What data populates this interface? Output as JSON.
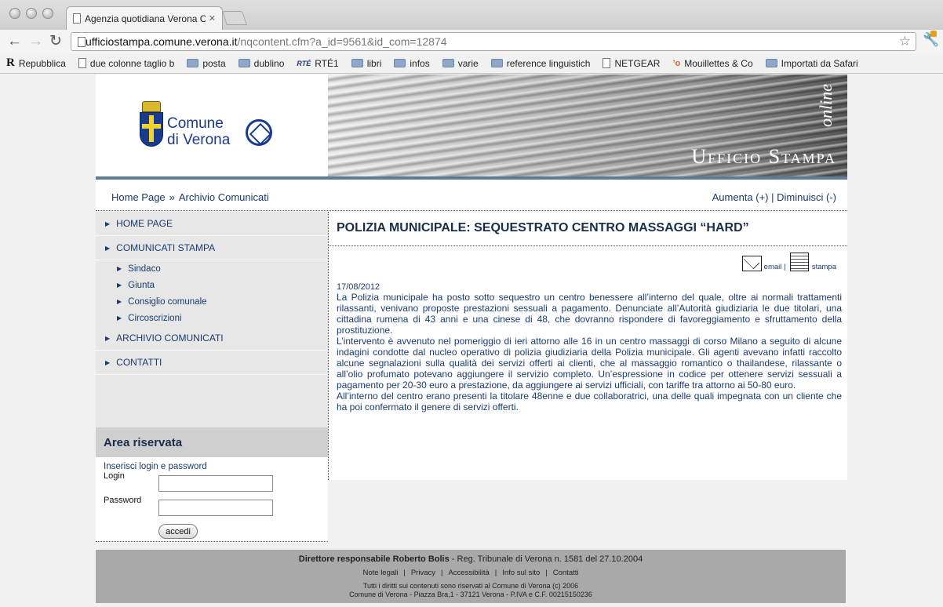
{
  "browser": {
    "tab_title": "Agenzia quotidiana Verona C",
    "tab_close": "✕",
    "url_host": "ufficiostampa.comune.verona.it",
    "url_path": "/nqcontent.cfm?a_id=9561&id_com=12874",
    "bookmarks": [
      {
        "label": "Repubblica",
        "icon": "r-icon"
      },
      {
        "label": "due colonne taglio b",
        "icon": "page-icon"
      },
      {
        "label": "posta",
        "icon": "folder-icon"
      },
      {
        "label": "dublino",
        "icon": "folder-icon"
      },
      {
        "label": "RTÉ1",
        "icon": "rte-icon",
        "icon_text": "RTÉ"
      },
      {
        "label": "libri",
        "icon": "folder-icon"
      },
      {
        "label": "infos",
        "icon": "folder-icon"
      },
      {
        "label": "varie",
        "icon": "folder-icon"
      },
      {
        "label": "reference linguistich",
        "icon": "folder-icon"
      },
      {
        "label": "NETGEAR",
        "icon": "page-icon"
      },
      {
        "label": "Mouillettes & Co",
        "icon": "mouillettes-icon",
        "icon_text": "’o"
      },
      {
        "label": "Importati da Safari",
        "icon": "folder-icon"
      }
    ]
  },
  "header": {
    "logo_line1": "Comune",
    "logo_line2": "di Verona",
    "banner_online": "online",
    "banner_title": "Ufficio Stampa"
  },
  "breadcrumb": {
    "home": "Home Page",
    "separator": "»",
    "current": "Archivio Comunicati"
  },
  "font_size": {
    "increase": "Aumenta (+)",
    "separator": "|",
    "decrease": "Diminuisci (-)"
  },
  "sidebar": {
    "items": [
      {
        "label": "HOME PAGE",
        "level": 1
      },
      {
        "label": "COMUNICATI STAMPA",
        "level": 1
      },
      {
        "label": "Sindaco",
        "level": 2
      },
      {
        "label": "Giunta",
        "level": 2
      },
      {
        "label": "Consiglio comunale",
        "level": 2
      },
      {
        "label": "Circoscrizioni",
        "level": 2
      },
      {
        "label": "ARCHIVIO COMUNICATI",
        "level": 1
      },
      {
        "label": "CONTATTI",
        "level": 1
      }
    ]
  },
  "area_riservata": {
    "title": "Area riservata",
    "hint": "Inserisci login e password",
    "login_label": "Login",
    "password_label": "Password",
    "submit_label": "accedi"
  },
  "article": {
    "title": "POLIZIA MUNICIPALE: SEQUESTRATO CENTRO MASSAGGI “HARD”",
    "email_label": "email",
    "tool_separator": "|",
    "print_label": "stampa",
    "date": "17/08/2012",
    "paragraphs": [
      "La Polizia municipale ha posto sotto sequestro un centro benessere all’interno del quale, oltre ai normali trattamenti rilassanti, venivano proposte prestazioni sessuali a pagamento. Denunciate all’Autorità giudiziaria le due titolari, una cittadina rumena di 43 anni e una cinese di 48, che dovranno rispondere di favoreggiamento e sfruttamento della prostituzione.",
      "L’intervento è avvenuto nel pomeriggio di ieri attorno alle 16 in un centro massaggi di corso Milano a seguito di alcune indagini condotte dal nucleo operativo di polizia giudiziaria della Polizia municipale. Gli agenti avevano infatti raccolto alcune segnalazioni sulla qualità dei servizi offerti ai clienti, che al massaggio romantico o thailandese, rilassante o all’olio profumato potevano aggiungere il servizio completo. Un’espressione in codice per ottenere servizi sessuali a pagamento per 20-30 euro a prestazione, da aggiungere ai servizi ufficiali, con tariffe tra attorno ai 50-80 euro.",
      "All’interno del centro erano presenti la titolare 48enne e due collaboratrici, una delle quali impegnata con un cliente che ha poi confermato il genere di servizi offerti."
    ]
  },
  "footer": {
    "director": "Direttore responsabile Roberto Bolis",
    "registration": " - Reg. Tribunale di Verona n. 1581 del 27.10.2004",
    "links": [
      "Note legali",
      "Privacy",
      "Accessibilità",
      "Info sul sito",
      "Contatti"
    ],
    "link_separator": "|",
    "rights": "Tutti i diritti sui contenuti sono riservati al Comune di Verona (c) 2006",
    "address": "Comune di Verona - Piazza Bra,1 - 37121 Verona - P.IVA e C.F. 00215150236"
  },
  "colors": {
    "link": "#1a3b6c",
    "header_line": "#5f7a9a",
    "sidebar_bg": "#e7e7e7",
    "footer_bg": "#a9a9a9"
  }
}
